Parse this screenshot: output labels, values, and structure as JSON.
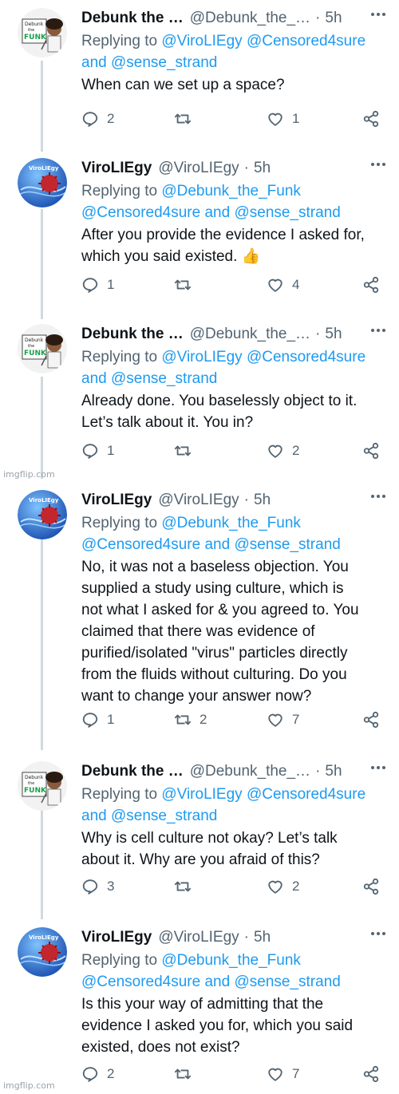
{
  "tweets": [
    {
      "name": "Debunk the …",
      "handle": "@Debunk_the_…",
      "time": "5h",
      "avatar": "debunk",
      "reply_label": "Replying to",
      "reply_line1": "@ViroLIEgy @Censored4sure",
      "reply_and": "and",
      "reply_line2_mention": "@sense_strand",
      "text_lines": [
        "When can we set up a space?"
      ],
      "replies": "2",
      "retweets": "",
      "likes": "1"
    },
    {
      "name": "ViroLIEgy",
      "handle": "@ViroLIEgy",
      "time": "5h",
      "avatar": "viro",
      "reply_label": "Replying to",
      "reply_line1": "@Debunk_the_Funk",
      "reply_line2_a": "@Censored4sure",
      "reply_and": "and",
      "reply_line2_b": "@sense_strand",
      "text_lines": [
        "After you provide the evidence I asked for,",
        "which you said existed. 👍"
      ],
      "replies": "1",
      "retweets": "",
      "likes": "4"
    },
    {
      "name": "Debunk the …",
      "handle": "@Debunk_the_…",
      "time": "5h",
      "avatar": "debunk",
      "reply_label": "Replying to",
      "reply_line1": "@ViroLIEgy @Censored4sure",
      "reply_and": "and",
      "reply_line2_mention": "@sense_strand",
      "text_lines": [
        "Already done. You baselessly object to it.",
        "Let’s talk about it. You in?"
      ],
      "replies": "1",
      "retweets": "",
      "likes": "2"
    },
    {
      "name": "ViroLIEgy",
      "handle": "@ViroLIEgy",
      "time": "5h",
      "avatar": "viro",
      "reply_label": "Replying to",
      "reply_line1": "@Debunk_the_Funk",
      "reply_line2_a": "@Censored4sure",
      "reply_and": "and",
      "reply_line2_b": "@sense_strand",
      "text_lines": [
        "No, it was not a baseless objection. You",
        "supplied a study using culture, which is",
        "not what I asked for & you agreed to. You",
        "claimed that there was evidence of",
        "purified/isolated \"virus\" particles directly",
        "from the fluids without culturing. Do you",
        "want to change your answer now?"
      ],
      "replies": "1",
      "retweets": "2",
      "likes": "7"
    },
    {
      "name": "Debunk the …",
      "handle": "@Debunk_the_…",
      "time": "5h",
      "avatar": "debunk",
      "reply_label": "Replying to",
      "reply_line1": "@ViroLIEgy @Censored4sure",
      "reply_and": "and",
      "reply_line2_mention": "@sense_strand",
      "text_lines": [
        "Why is cell culture not okay? Let’s talk",
        "about it. Why are you afraid of this?"
      ],
      "replies": "3",
      "retweets": "",
      "likes": "2"
    },
    {
      "name": "ViroLIEgy",
      "handle": "@ViroLIEgy",
      "time": "5h",
      "avatar": "viro",
      "reply_label": "Replying to",
      "reply_line1": "@Debunk_the_Funk",
      "reply_line2_a": "@Censored4sure",
      "reply_and": "and",
      "reply_line2_b": "@sense_strand",
      "text_lines": [
        "Is this your way of admitting that the",
        "evidence I asked you for, which you said",
        "existed, does not exist?"
      ],
      "replies": "2",
      "retweets": "",
      "likes": "7"
    }
  ],
  "watermark": "imgflip.com",
  "avatar_text": {
    "debunk_top": "Debunk",
    "debunk_mid": "the",
    "debunk_logo": "FUNK",
    "viro_logo": "ViroLIEgy"
  },
  "colors": {
    "link": "#1d9bf0",
    "muted": "#536471",
    "text": "#0f1419",
    "funk_green": "#1aa24a",
    "viro_blue": "#1a4fb0"
  }
}
